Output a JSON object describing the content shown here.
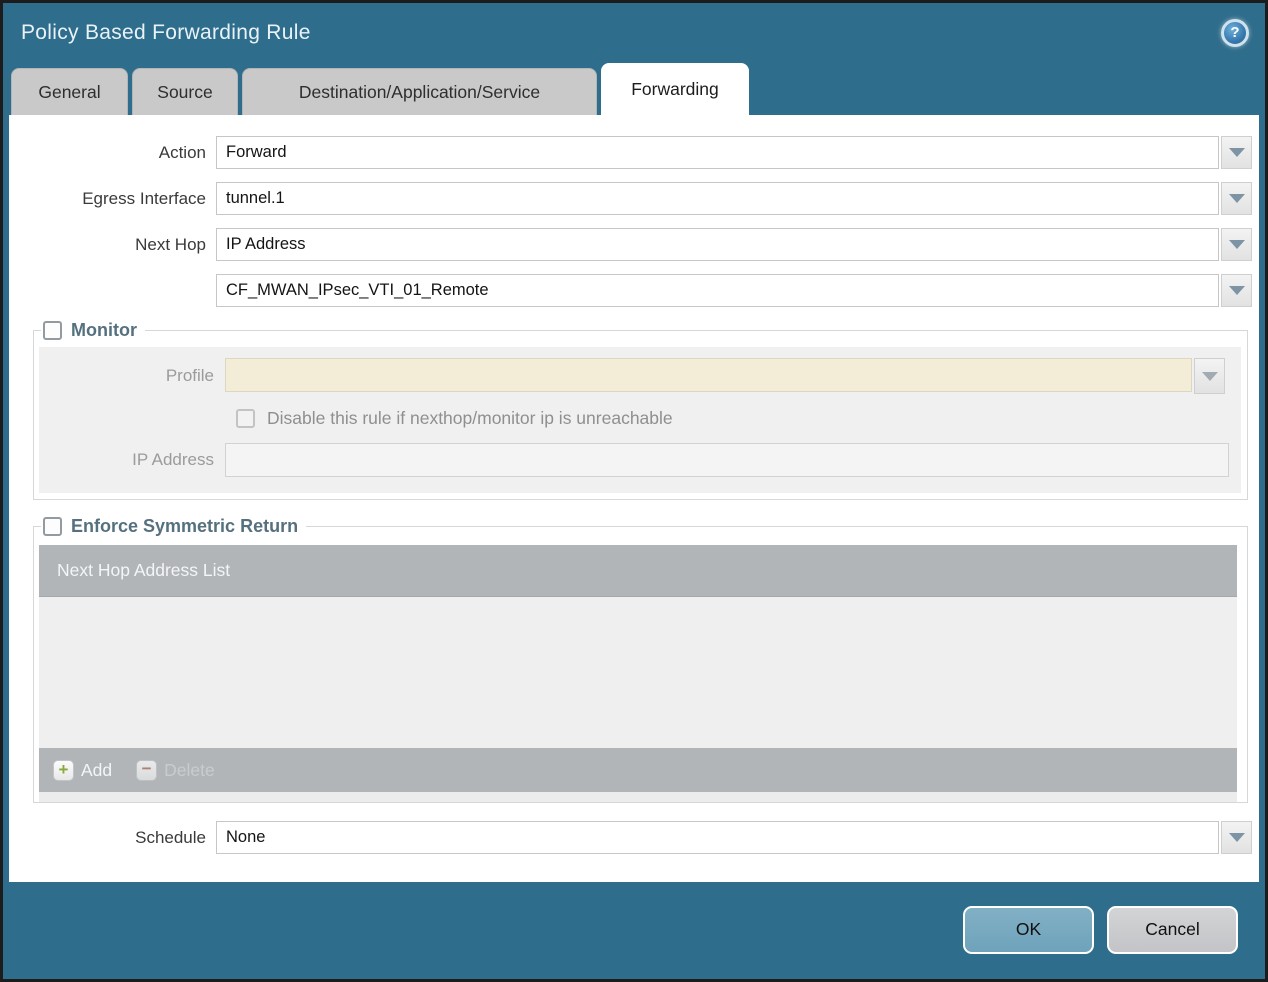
{
  "dialog": {
    "title": "Policy Based Forwarding Rule",
    "help_glyph": "?"
  },
  "tabs": [
    {
      "label": "General",
      "active": false
    },
    {
      "label": "Source",
      "active": false
    },
    {
      "label": "Destination/Application/Service",
      "active": false
    },
    {
      "label": "Forwarding",
      "active": true
    }
  ],
  "form": {
    "action": {
      "label": "Action",
      "value": "Forward"
    },
    "egress_interface": {
      "label": "Egress Interface",
      "value": "tunnel.1"
    },
    "next_hop": {
      "label": "Next Hop",
      "value": "IP Address"
    },
    "next_hop_address": {
      "value": "CF_MWAN_IPsec_VTI_01_Remote"
    },
    "schedule": {
      "label": "Schedule",
      "value": "None"
    }
  },
  "monitor": {
    "title": "Monitor",
    "checked": false,
    "profile": {
      "label": "Profile",
      "value": ""
    },
    "disable_rule_label": "Disable this rule if nexthop/monitor ip is unreachable",
    "ip_address": {
      "label": "IP Address",
      "value": ""
    }
  },
  "symmetric_return": {
    "title": "Enforce Symmetric Return",
    "checked": false,
    "list_header": "Next Hop Address List",
    "rows": [],
    "add_label": "Add",
    "add_glyph": "+",
    "delete_label": "Delete",
    "delete_glyph": "−"
  },
  "footer": {
    "ok_label": "OK",
    "cancel_label": "Cancel"
  },
  "colors": {
    "titlebar": "#2f6d8c",
    "active_tab": "#ffffff",
    "inactive_tab": "#c9c9c9",
    "disabled_field": "#f3edd8",
    "list_bar": "#b1b5b8",
    "ok_button": "#74a7be",
    "cancel_button": "#c9cacd",
    "section_heading": "#55707f"
  }
}
